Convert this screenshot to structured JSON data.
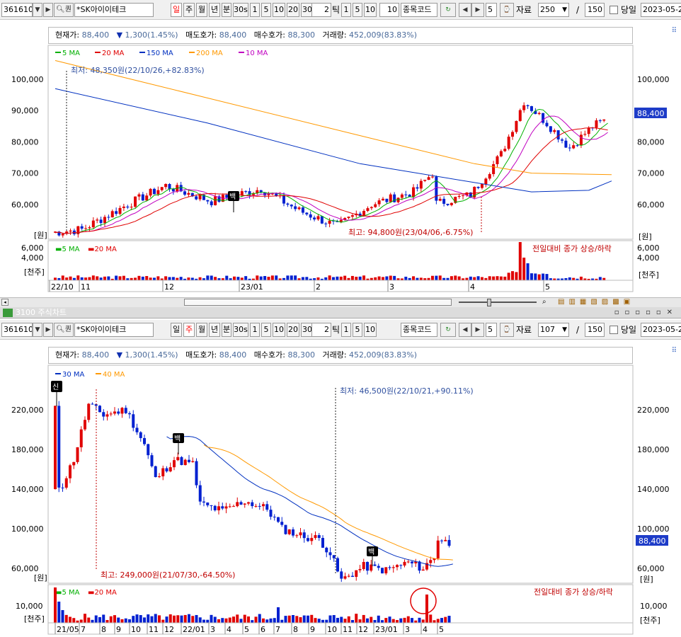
{
  "toolbar1": {
    "code": "361610",
    "name": "*SK아이이테크",
    "search_label": "Q",
    "period_buttons": [
      "일",
      "주",
      "월",
      "년",
      "분",
      "30s",
      "1",
      "5",
      "10",
      "20",
      "30"
    ],
    "active_period": "일",
    "tick_value": "2",
    "tick_label": "틱",
    "tick_buttons": [
      "1",
      "5",
      "10"
    ],
    "tick_custom": "10",
    "stock_code_label": "종목코드",
    "step_value": "5",
    "data_label": "자료",
    "data_count": "250",
    "separator": "/",
    "data_max": "150",
    "same_day_label": "당일",
    "date": "2023-05-2"
  },
  "toolbar2": {
    "code": "361610",
    "name": "*SK아이이테크",
    "period_buttons": [
      "일",
      "주",
      "월",
      "년",
      "분",
      "30s",
      "1",
      "5",
      "10",
      "20",
      "30"
    ],
    "active_period": "주",
    "tick_value": "2",
    "tick_label": "틱",
    "tick_buttons": [
      "1",
      "5",
      "10"
    ],
    "stock_code_label": "종목코드",
    "step_value": "5",
    "data_label": "자료",
    "data_count": "107",
    "separator": "/",
    "data_max": "150",
    "same_day_label": "당일",
    "date": "2023-05-2"
  },
  "window2_title": "3100 주식차트",
  "info": {
    "current_label": "현재가:",
    "current_value": "88,400",
    "change_arrow": "▼",
    "change_value": "1,300(1.45%)",
    "ask_label": "매도호가:",
    "ask_value": "88,400",
    "bid_label": "매수호가:",
    "bid_value": "88,300",
    "volume_label": "거래량:",
    "volume_value": "452,009(83.83%)"
  },
  "chart1": {
    "legend": [
      "5 MA",
      "20 MA",
      "150 MA",
      "200 MA",
      "10 MA"
    ],
    "legend_colors": [
      "#00b000",
      "#e00000",
      "#0030c0",
      "#ff9900",
      "#c000c0"
    ],
    "y_ticks": [
      "100,000",
      "90,000",
      "80,000",
      "70,000",
      "60,000"
    ],
    "y_unit": "[원]",
    "low_annotation": "최저: 48,350원(22/10/26,+82.83%)",
    "high_annotation": "최고: 94,800원(23/04/06,-6.75%)",
    "price_badge": "88,400",
    "marker_label": "백",
    "volume_legend": [
      "5 MA",
      "20 MA"
    ],
    "volume_note": "전일대비 종가 상승/하락",
    "volume_ticks": [
      "6,000",
      "4,000"
    ],
    "volume_unit": "[천주]",
    "x_labels": [
      "22/10",
      "11",
      "12",
      "23/01",
      "2",
      "3",
      "4",
      "5"
    ]
  },
  "chart2": {
    "legend": [
      "30 MA",
      "40 MA"
    ],
    "legend_colors": [
      "#0030c0",
      "#ff9900"
    ],
    "y_ticks": [
      "220,000",
      "180,000",
      "140,000",
      "100,000",
      "60,000"
    ],
    "y_unit": "[원]",
    "low_annotation": "최저: 46,500원(22/10/21,+90.11%)",
    "high_annotation": "최고: 249,000원(21/07/30,-64.50%)",
    "price_badge": "88,400",
    "marker_new": "신",
    "marker_label": "백",
    "volume_legend": [
      "5 MA",
      "20 MA"
    ],
    "volume_note": "전일대비 종가 상승/하락",
    "volume_ticks": [
      "10,000"
    ],
    "volume_unit": "[천주]",
    "x_labels": [
      "21/05",
      "7",
      "8",
      "9",
      "10",
      "11",
      "12",
      "22/01",
      "3",
      "4",
      "5",
      "6",
      "7",
      "8",
      "9",
      "10",
      "11",
      "12",
      "23/01",
      "3",
      "4",
      "5"
    ]
  }
}
